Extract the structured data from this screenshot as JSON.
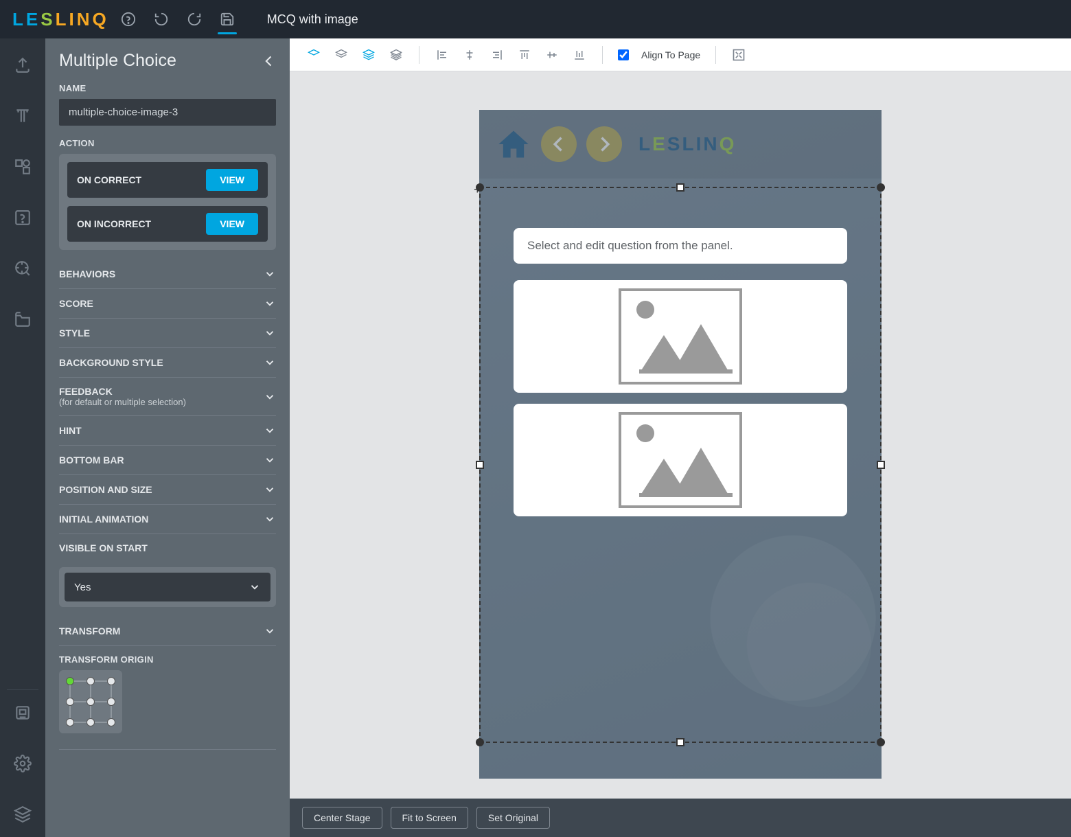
{
  "app": {
    "title": "MCQ with image"
  },
  "topbar_icons": [
    "help",
    "undo",
    "redo",
    "save"
  ],
  "leftnav_icons": [
    "upload",
    "text",
    "shapes",
    "help-square",
    "target",
    "folder-open",
    "disk",
    "gear",
    "layers"
  ],
  "panel": {
    "title": "Multiple Choice",
    "name_label": "NAME",
    "name_value": "multiple-choice-image-3",
    "action_label": "ACTION",
    "actions": [
      {
        "label": "ON CORRECT",
        "btn": "VIEW"
      },
      {
        "label": "ON INCORRECT",
        "btn": "VIEW"
      }
    ],
    "accordions": [
      "BEHAVIORS",
      "SCORE",
      "STYLE",
      "BACKGROUND STYLE"
    ],
    "feedback": {
      "label": "FEEDBACK",
      "sub": "(for default or multiple selection)"
    },
    "accordions2": [
      "HINT",
      "BOTTOM BAR",
      "POSITION AND SIZE",
      "INITIAL ANIMATION"
    ],
    "visible_label": "VISIBLE ON START",
    "visible_value": "Yes",
    "transform_label": "TRANSFORM",
    "transform_origin_label": "TRANSFORM ORIGIN"
  },
  "toolbar": {
    "align_label": "Align To Page",
    "align_checked": true
  },
  "canvas": {
    "question_placeholder": "Select and edit question from the panel."
  },
  "footer": {
    "center": "Center Stage",
    "fit": "Fit to Screen",
    "orig": "Set Original"
  }
}
